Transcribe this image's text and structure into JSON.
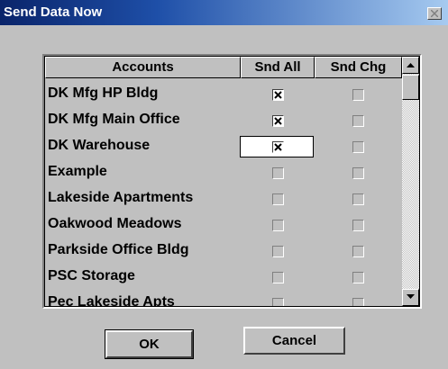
{
  "window": {
    "title": "Send Data Now"
  },
  "grid": {
    "columns": [
      "Accounts",
      "Snd All",
      "Snd Chg"
    ],
    "rows": [
      {
        "account": "DK Mfg HP Bldg",
        "snd_all": true,
        "snd_chg": false
      },
      {
        "account": "DK Mfg Main Office",
        "snd_all": true,
        "snd_chg": false
      },
      {
        "account": "DK Warehouse",
        "snd_all": true,
        "snd_chg": false
      },
      {
        "account": "Example",
        "snd_all": false,
        "snd_chg": false
      },
      {
        "account": "Lakeside Apartments",
        "snd_all": false,
        "snd_chg": false
      },
      {
        "account": "Oakwood Meadows",
        "snd_all": false,
        "snd_chg": false
      },
      {
        "account": "Parkside Office Bldg",
        "snd_all": false,
        "snd_chg": false
      },
      {
        "account": "PSC Storage",
        "snd_all": false,
        "snd_chg": false
      },
      {
        "account": "Pec Lakeside Apts",
        "snd_all": false,
        "snd_chg": false
      }
    ]
  },
  "buttons": {
    "ok": "OK",
    "cancel": "Cancel"
  },
  "icons": {
    "close": "close-icon",
    "scroll_up": "arrow-up-icon",
    "scroll_down": "arrow-down-icon"
  }
}
